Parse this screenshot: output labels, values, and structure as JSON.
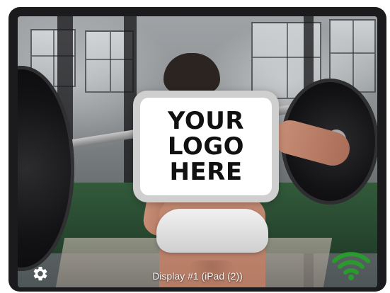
{
  "screen": {
    "background_image": "woman-lifting-barbell-gym-photo",
    "logo": {
      "lines": [
        "YOUR",
        "LOGO",
        "HERE"
      ]
    },
    "status": {
      "display_label": "Display #1 (iPad (2))",
      "settings_icon": "gear-icon",
      "connection_icon": "wifi-icon",
      "connection_color": "#2a9a2f"
    }
  }
}
